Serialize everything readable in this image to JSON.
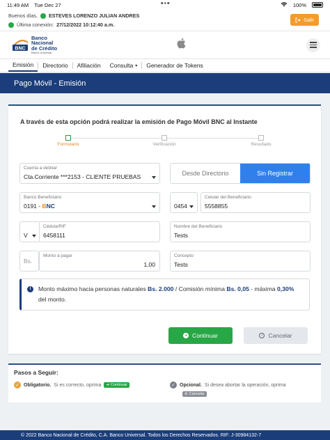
{
  "status_bar": {
    "time": "11:49 AM",
    "date": "Tue Dec 27",
    "battery": "100%"
  },
  "session": {
    "greeting": "Buenos días,",
    "user": "ESTEVES LORENZO JULIAN ANDRES",
    "last_conn_label": "Última conexión:",
    "last_conn_value": "27/12/2022 10:12:40 a.m.",
    "exit_label": "Salir"
  },
  "brand": {
    "line1": "Banco",
    "line2": "Nacional",
    "line3": "de Crédito",
    "tagline": "Banco Universal",
    "short": "BNC"
  },
  "nav": {
    "items": [
      {
        "label": "Emisión"
      },
      {
        "label": "Directorio"
      },
      {
        "label": "Afiliación"
      },
      {
        "label": "Consulta"
      },
      {
        "label": "Generador de Tokens"
      }
    ]
  },
  "page_title": "Pago Móvil - Emisión",
  "form": {
    "intro": "A través de esta opción podrá realizar la emisión de Pago Móvil BNC al Instante",
    "steps": [
      "Formulario",
      "Verificación",
      "Resultado"
    ],
    "debit_account": {
      "label": "Cuenta a debitar",
      "value": "Cta.Corriente ***2153 - CLIENTE PRUEBAS"
    },
    "source_toggle": {
      "off": "Desde Directorio",
      "on": "Sin Registrar"
    },
    "bank": {
      "label": "Banco Beneficiario",
      "code": "0191 - ",
      "name_b": "B",
      "name_n": "N",
      "name_c": "C"
    },
    "phone_prefix": {
      "value": "0454"
    },
    "phone": {
      "label": "Celular del Beneficiario",
      "value": "5558855"
    },
    "doc_type": {
      "value": "V"
    },
    "doc_id": {
      "label": "Cédula/RIF",
      "value": "6458111"
    },
    "name": {
      "label": "Nombre del Beneficiario",
      "value": "Tests"
    },
    "currency": {
      "value": "Bs."
    },
    "amount": {
      "label": "Monto a pagar",
      "value": "1,00"
    },
    "concept": {
      "label": "Concepto",
      "value": "Tests"
    },
    "notice": {
      "t1": "Monto máximo hacia personas naturales",
      "a1": "Bs. 2.000",
      "t2": "/ Comisión mínima",
      "a2": "Bs. 0,05",
      "t3": "-",
      "t4": "máxima",
      "a3": "0,30%",
      "t5": "del monto."
    },
    "continue_label": "Continuar",
    "cancel_label": "Cancelar"
  },
  "guide": {
    "title": "Pasos a Seguir:",
    "left_bold": "Obligatorio.",
    "left_text": "Si es correcto, oprima",
    "left_chip": "Continuar",
    "right_bold": "Opcional.",
    "right_text": "Si desea abortar la operación, oprima",
    "right_chip": "Cancelar"
  },
  "footer": "© 2022 Banco Nacional de Crédito, C.A. Banco Universal.   Todos los Derechos Reservados. RIF: J-30984132-7",
  "colors": {
    "brand_blue": "#1b3d7a",
    "accent_blue": "#2f80ed",
    "success": "#27a745",
    "warning": "#f39c2b"
  }
}
